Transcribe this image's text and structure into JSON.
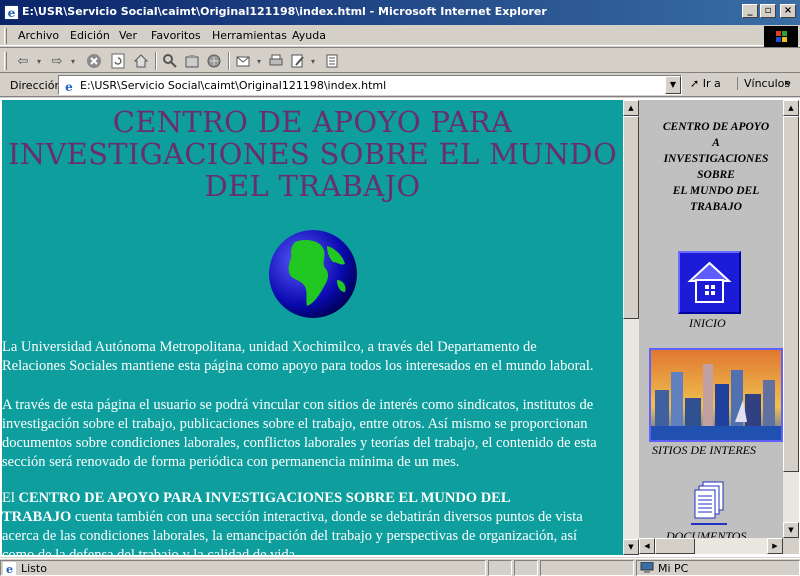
{
  "window": {
    "title": "E:\\USR\\Servicio Social\\caimt\\Original121198\\index.html - Microsoft Internet Explorer"
  },
  "menu": [
    "Archivo",
    "Edición",
    "Ver",
    "Favoritos",
    "Herramientas",
    "Ayuda"
  ],
  "toolbar": {
    "icons": [
      "back-icon",
      "forward-icon",
      "stop-icon",
      "refresh-icon",
      "home-icon",
      "search-icon",
      "favorites-icon",
      "history-icon",
      "mail-icon",
      "print-icon",
      "edit-icon",
      "discuss-icon"
    ]
  },
  "address": {
    "label": "Dirección",
    "value": "E:\\USR\\Servicio Social\\caimt\\Original121198\\index.html",
    "go_label": "Ir a",
    "links_label": "Vínculos"
  },
  "content": {
    "title_line1": "CENTRO DE APOYO PARA",
    "title_line2": "INVESTIGACIONES SOBRE EL MUNDO",
    "title_line3": "DEL TRABAJO",
    "p1_line1": "La Universidad Autónoma Metropolitana, unidad Xochimilco, a través del Departamento de",
    "p1_line2": "Relaciones Sociales mantiene esta página como apoyo para todos los interesados en el mundo laboral.",
    "p2_line1": "A través de esta página el usuario se podrá vincular con sitios de interés como sindicatos, institutos de",
    "p2_line2": "investigación sobre el trabajo, publicaciones sobre el trabajo, entre otros. Así mismo se proporcionan",
    "p2_line3": "documentos sobre condiciones laborales, conflictos laborales y teorías del trabajo, el contenido de esta",
    "p2_line4": "sección será renovado de forma periódica con permanencia mínima de un mes.",
    "p3_prefix": "El ",
    "p3_bold1": "CENTRO DE APOYO PARA INVESTIGACIONES SOBRE EL MUNDO DEL",
    "p3_bold2": "TRABAJO",
    "p3_rest2": " cuenta también con una sección interactiva, donde se debatirán diversos puntos de vista",
    "p3_line3": "acerca de las condiciones laborales, la emancipación del trabajo y perspectivas de organización, así",
    "p3_line4": "como de la defensa del trabajo y la calidad de vida."
  },
  "side": {
    "title_lines": [
      "CENTRO DE APOYO",
      "A",
      "INVESTIGACIONES",
      "SOBRE",
      "EL MUNDO DEL",
      "TRABAJO"
    ],
    "inicio": "INICIO",
    "sitios": "SITIOS DE INTERES",
    "documentos": "DOCUMENTOS"
  },
  "status": {
    "text": "Listo",
    "zone": "Mi PC"
  },
  "colors": {
    "page_bg": "#0e9e9e",
    "title": "#6a2f6a",
    "sidebar_bg": "#c0c0c0",
    "titlebar": "#0a246a"
  }
}
